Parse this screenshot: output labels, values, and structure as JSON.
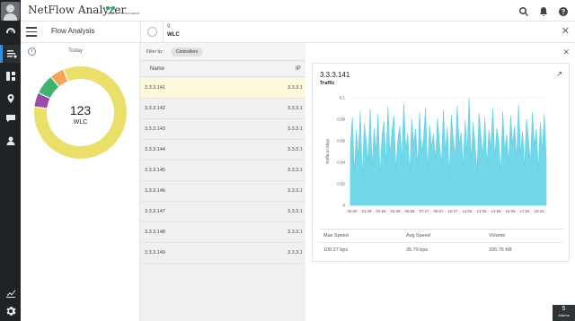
{
  "app": {
    "title": "NetFlow Analyzer",
    "perf_label": "System Performance"
  },
  "subhead": {
    "section": "Flow Analysis",
    "count": "9",
    "type": "WLC"
  },
  "donut": {
    "period": "Today",
    "total": "123",
    "label": "WLC",
    "segments": [
      {
        "name": "yellow",
        "color": "#eadf6a",
        "share": 0.83
      },
      {
        "name": "purple",
        "color": "#9b4aa8",
        "share": 0.05
      },
      {
        "name": "green",
        "color": "#3cb371",
        "share": 0.07
      },
      {
        "name": "orange",
        "color": "#f2a65a",
        "share": 0.05
      }
    ]
  },
  "filter": {
    "label": "Filter by :",
    "chip": "Controllers"
  },
  "table": {
    "headers": [
      "Name",
      "IP"
    ],
    "rows": [
      {
        "name": "3.3.3.141",
        "ip": "3.3.3.1"
      },
      {
        "name": "3.3.3.142",
        "ip": "3.3.3.1"
      },
      {
        "name": "3.3.3.143",
        "ip": "3.3.3.1"
      },
      {
        "name": "3.3.3.144",
        "ip": "3.3.3.1"
      },
      {
        "name": "3.3.3.145",
        "ip": "3.3.3.1"
      },
      {
        "name": "3.3.3.146",
        "ip": "3.3.3.1"
      },
      {
        "name": "3.3.3.147",
        "ip": "3.3.3.1"
      },
      {
        "name": "3.3.3.148",
        "ip": "3.3.3.1"
      },
      {
        "name": "3.3.3.149",
        "ip": "3.3.3.1"
      }
    ]
  },
  "detail": {
    "ip": "3.3.3.141",
    "subtitle": "Traffic",
    "stats_headers": [
      "Max Speed",
      "Avg Speed",
      "Volume"
    ],
    "stats_values": [
      "100.27 bps",
      "35.79 bps",
      "336.76 KB"
    ]
  },
  "chart_data": {
    "type": "area",
    "title": "",
    "ylabel": "Traffic in Kbps",
    "xlabel": "",
    "ylim": [
      0,
      0.1
    ],
    "yticks": [
      0,
      0.02,
      0.04,
      0.06,
      0.08,
      0.1
    ],
    "xticks": [
      "00:00",
      "01:29",
      "02:59",
      "04:28",
      "05:58",
      "07:27",
      "08:57",
      "10:27",
      "11:56",
      "13:26",
      "14:55",
      "16:25",
      "17:54",
      "19:24"
    ],
    "color": "#5bd0e6",
    "values": [
      0.055,
      0.082,
      0.03,
      0.07,
      0.045,
      0.088,
      0.025,
      0.076,
      0.06,
      0.04,
      0.09,
      0.035,
      0.072,
      0.05,
      0.085,
      0.028,
      0.065,
      0.078,
      0.038,
      0.092,
      0.047,
      0.069,
      0.083,
      0.033,
      0.061,
      0.074,
      0.042,
      0.095,
      0.052,
      0.067,
      0.029,
      0.08,
      0.057,
      0.071,
      0.036,
      0.087,
      0.048,
      0.063,
      0.091,
      0.031,
      0.075,
      0.054,
      0.066,
      0.043,
      0.081,
      0.059,
      0.038,
      0.089,
      0.05,
      0.073,
      0.027,
      0.084,
      0.062,
      0.045,
      0.093,
      0.056,
      0.068,
      0.034,
      0.079,
      0.049,
      0.1,
      0.041,
      0.077,
      0.058,
      0.032,
      0.086,
      0.064,
      0.046,
      0.082,
      0.037,
      0.07,
      0.053,
      0.09,
      0.044,
      0.072,
      0.06,
      0.03,
      0.088,
      0.051,
      0.066,
      0.039,
      0.083,
      0.057,
      0.074,
      0.043,
      0.094,
      0.048,
      0.069,
      0.035,
      0.08,
      0.062,
      0.04,
      0.087,
      0.055,
      0.071,
      0.033,
      0.078,
      0.05,
      0.085,
      0.045
    ]
  },
  "alarms": {
    "count": "5",
    "label": "Alarms"
  }
}
